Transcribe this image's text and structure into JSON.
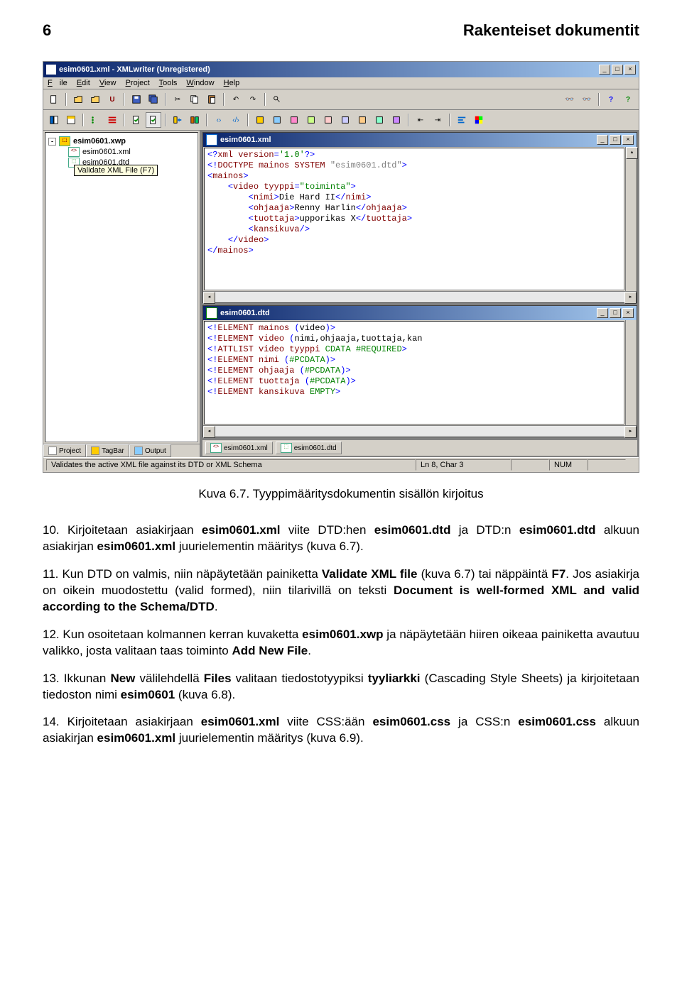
{
  "header": {
    "page_num": "6",
    "title": "Rakenteiset dokumentit"
  },
  "screenshot": {
    "app_title": "esim0601.xml - XMLwriter (Unregistered)",
    "menu": {
      "file": "File",
      "edit": "Edit",
      "view": "View",
      "project": "Project",
      "tools": "Tools",
      "window": "Window",
      "help": "Help"
    },
    "tooltip": "Validate XML File (F7)",
    "tree": {
      "root": "esim0601.xwp",
      "items": [
        "esim0601.xml",
        "esim0601.dtd"
      ]
    },
    "sidebar_tabs": {
      "project": "Project",
      "tagbar": "TagBar",
      "output": "Output"
    },
    "xml_window": {
      "title": "esim0601.xml",
      "lines": [
        {
          "pre": "",
          "t": [
            [
              "blue",
              "<?"
            ],
            [
              "red",
              "xml version"
            ],
            [
              "blue",
              "="
            ],
            [
              "green",
              "'1.0'"
            ],
            [
              "blue",
              "?>"
            ]
          ]
        },
        {
          "pre": "",
          "t": [
            [
              "blue",
              "<!"
            ],
            [
              "red",
              "DOCTYPE mainos SYSTEM "
            ],
            [
              "gray",
              "\"esim0601.dtd\""
            ],
            [
              "blue",
              ">"
            ]
          ]
        },
        {
          "pre": "",
          "t": [
            [
              "blue",
              "<"
            ],
            [
              "red",
              "mainos"
            ],
            [
              "blue",
              ">"
            ]
          ]
        },
        {
          "pre": "    ",
          "t": [
            [
              "blue",
              "<"
            ],
            [
              "red",
              "video "
            ],
            [
              "red",
              "tyyppi"
            ],
            [
              "blue",
              "="
            ],
            [
              "green",
              "\"toiminta\""
            ],
            [
              "blue",
              ">"
            ]
          ]
        },
        {
          "pre": "        ",
          "t": [
            [
              "blue",
              "<"
            ],
            [
              "red",
              "nimi"
            ],
            [
              "blue",
              ">"
            ],
            [
              "",
              "Die Hard II"
            ],
            [
              "blue",
              "</"
            ],
            [
              "red",
              "nimi"
            ],
            [
              "blue",
              ">"
            ]
          ]
        },
        {
          "pre": "        ",
          "t": [
            [
              "blue",
              "<"
            ],
            [
              "red",
              "ohjaaja"
            ],
            [
              "blue",
              ">"
            ],
            [
              "",
              "Renny Harlin"
            ],
            [
              "blue",
              "</"
            ],
            [
              "red",
              "ohjaaja"
            ],
            [
              "blue",
              ">"
            ]
          ]
        },
        {
          "pre": "        ",
          "t": [
            [
              "blue",
              "<"
            ],
            [
              "red",
              "tuottaja"
            ],
            [
              "blue",
              ">"
            ],
            [
              "",
              "upporikas X"
            ],
            [
              "blue",
              "</"
            ],
            [
              "red",
              "tuottaja"
            ],
            [
              "blue",
              ">"
            ]
          ]
        },
        {
          "pre": "        ",
          "t": [
            [
              "blue",
              "<"
            ],
            [
              "red",
              "kansikuva"
            ],
            [
              "blue",
              "/>"
            ]
          ]
        },
        {
          "pre": "    ",
          "t": [
            [
              "blue",
              "</"
            ],
            [
              "red",
              "video"
            ],
            [
              "blue",
              ">"
            ]
          ]
        },
        {
          "pre": "",
          "t": [
            [
              "blue",
              "</"
            ],
            [
              "red",
              "mainos"
            ],
            [
              "blue",
              ">"
            ]
          ]
        }
      ]
    },
    "dtd_window": {
      "title": "esim0601.dtd",
      "lines": [
        {
          "pre": "",
          "t": [
            [
              "blue",
              "<!"
            ],
            [
              "red",
              "ELEMENT mainos "
            ],
            [
              "blue",
              "("
            ],
            [
              "",
              "video"
            ],
            [
              "blue",
              ")>"
            ]
          ]
        },
        {
          "pre": "",
          "t": [
            [
              "blue",
              "<!"
            ],
            [
              "red",
              "ELEMENT video "
            ],
            [
              "blue",
              "("
            ],
            [
              "",
              "nimi,ohjaaja,tuottaja,kan"
            ]
          ]
        },
        {
          "pre": "",
          "t": [
            [
              "blue",
              "<!"
            ],
            [
              "red",
              "ATTLIST video tyyppi "
            ],
            [
              "green",
              "CDATA #REQUIRED"
            ],
            [
              "blue",
              ">"
            ]
          ]
        },
        {
          "pre": "",
          "t": [
            [
              "blue",
              "<!"
            ],
            [
              "red",
              "ELEMENT nimi "
            ],
            [
              "blue",
              "("
            ],
            [
              "green",
              "#PCDATA"
            ],
            [
              "blue",
              ")>"
            ]
          ]
        },
        {
          "pre": "",
          "t": [
            [
              "blue",
              "<!"
            ],
            [
              "red",
              "ELEMENT ohjaaja "
            ],
            [
              "blue",
              "("
            ],
            [
              "green",
              "#PCDATA"
            ],
            [
              "blue",
              ")>"
            ]
          ]
        },
        {
          "pre": "",
          "t": [
            [
              "blue",
              "<!"
            ],
            [
              "red",
              "ELEMENT tuottaja "
            ],
            [
              "blue",
              "("
            ],
            [
              "green",
              "#PCDATA"
            ],
            [
              "blue",
              ")>"
            ]
          ]
        },
        {
          "pre": "",
          "t": [
            [
              "blue",
              "<!"
            ],
            [
              "red",
              "ELEMENT kansikuva "
            ],
            [
              "green",
              "EMPTY"
            ],
            [
              "blue",
              ">"
            ]
          ]
        }
      ]
    },
    "doc_tabs": {
      "xml": "esim0601.xml",
      "dtd": "esim0601.dtd"
    },
    "status": {
      "left": "Validates the active XML file against its DTD or XML Schema",
      "pos": "Ln 8, Char 3",
      "num": "NUM"
    }
  },
  "caption": "Kuva 6.7. Tyyppimääritysdokumentin sisällön kirjoitus",
  "paragraphs": {
    "p10": "10. Kirjoitetaan asiakirjaan <b>esim0601.xml</b> viite DTD:hen <b>esim0601.dtd</b> ja DTD:n <b>esim0601.dtd</b> alkuun asiakirjan <b>esim0601.xml</b> juurielementin määritys (kuva 6.7).",
    "p11": "11. Kun DTD on valmis, niin näpäytetään painiketta <b>Validate XML file</b> (kuva 6.7) tai näppäintä <b>F7</b>. Jos asiakirja on oikein muodostettu (valid formed), niin tilarivillä on teksti <b>Document is well-formed XML and valid according to the Schema/DTD</b>.",
    "p12": "12. Kun osoitetaan kolmannen kerran kuvaketta <b>esim0601.xwp</b> ja näpäytetään hiiren oikeaa painiketta avautuu valikko, josta valitaan taas toiminto <b>Add New File</b>.",
    "p13": "13. Ikkunan <b>New</b> välilehdellä <b>Files</b> valitaan tiedostotyypiksi <b>tyyliarkki</b> (Cascading Style Sheets) ja kirjoitetaan tiedoston nimi <b>esim0601</b> (kuva 6.8).",
    "p14": "14. Kirjoitetaan asiakirjaan <b>esim0601.xml</b> viite CSS:ään <b>esim0601.css</b> ja CSS:n <b>esim0601.css</b> alkuun asiakirjan <b>esim0601.xml</b> juurielementin määritys (kuva 6.9)."
  }
}
